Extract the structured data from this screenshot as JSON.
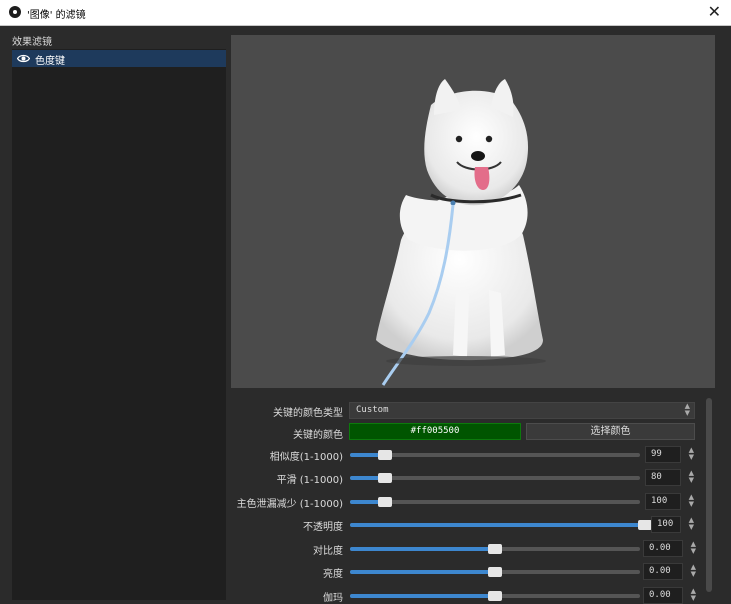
{
  "window": {
    "title": "'图像' 的滤镜",
    "close_icon": "close-icon",
    "close_glyph": "✕"
  },
  "filters": {
    "label": "效果滤镜",
    "items": [
      {
        "label": "色度键",
        "icon": "eye-icon"
      }
    ]
  },
  "preview": {
    "subject": "white Samoyed dog photo on gray background"
  },
  "properties": {
    "key_color_type": {
      "label": "关键的颜色类型",
      "value": "Custom"
    },
    "key_color": {
      "label": "关键的颜色",
      "value": "#ff005500",
      "button_label": "选择颜色",
      "swatch_color": "#005500"
    },
    "sliders": [
      {
        "label": "相似度(1-1000)",
        "value": "99",
        "min": 1,
        "max": 1000,
        "current": 99
      },
      {
        "label": "平滑 (1-1000)",
        "value": "80",
        "min": 1,
        "max": 1000,
        "current": 80
      },
      {
        "label": "主色泄漏减少 (1-1000)",
        "value": "100",
        "min": 1,
        "max": 1000,
        "current": 100
      },
      {
        "label": "不透明度",
        "value": "100",
        "min": 0,
        "max": 100,
        "current": 100
      },
      {
        "label": "对比度",
        "value": "0.00",
        "min": -1,
        "max": 1,
        "current": 0
      },
      {
        "label": "亮度",
        "value": "0.00",
        "min": -1,
        "max": 1,
        "current": 0
      },
      {
        "label": "伽玛",
        "value": "0.00",
        "min": -1,
        "max": 1,
        "current": 0
      }
    ]
  },
  "colors": {
    "accent": "#3d87cf",
    "selection": "#1e3a5c",
    "panel": "#1f1f1f",
    "window": "#2b2b2b"
  }
}
